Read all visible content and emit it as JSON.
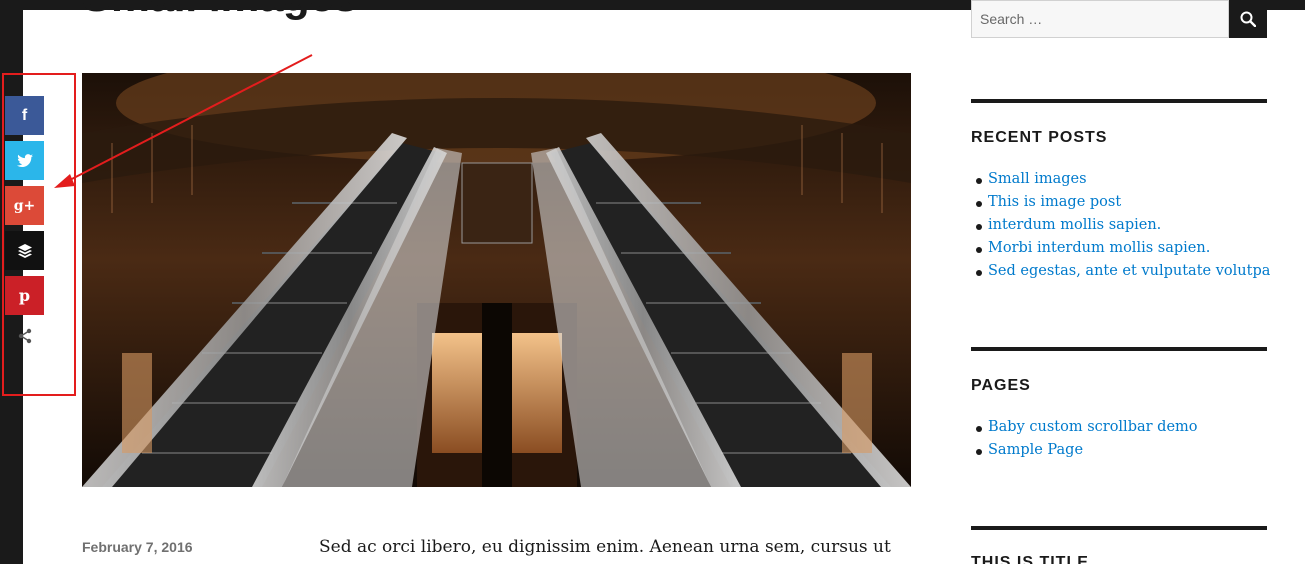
{
  "post": {
    "title": "Small images",
    "date": "February 7, 2016",
    "excerpt": "Sed ac orci libero, eu dignissim enim. Aenean urna sem, cursus ut"
  },
  "share_bar": {
    "buttons": [
      {
        "name": "facebook",
        "glyph": "f"
      },
      {
        "name": "twitter",
        "glyph": "t"
      },
      {
        "name": "google-plus",
        "glyph": "g+"
      },
      {
        "name": "buffer",
        "glyph": "≡"
      },
      {
        "name": "pinterest",
        "glyph": "p"
      }
    ],
    "colors": {
      "facebook": "#3b5998",
      "twitter": "#2bb6ea",
      "google_plus": "#dc4a38",
      "buffer": "#111111",
      "pinterest": "#cb2027"
    }
  },
  "annotation": {
    "color": "#e31d1d"
  },
  "sidebar": {
    "search": {
      "placeholder": "Search …"
    },
    "recent_posts": {
      "title": "RECENT POSTS",
      "items": [
        "Small images",
        "This is image post",
        "interdum mollis sapien.",
        "Morbi interdum mollis sapien.",
        "Sed egestas, ante et vulputate volutpa"
      ]
    },
    "pages": {
      "title": "PAGES",
      "items": [
        "Baby custom scrollbar demo",
        "Sample Page"
      ]
    },
    "next_widget": {
      "title": "THIS IS TITLE"
    }
  },
  "colors": {
    "link": "#007acc",
    "text": "#1a1a1a"
  }
}
